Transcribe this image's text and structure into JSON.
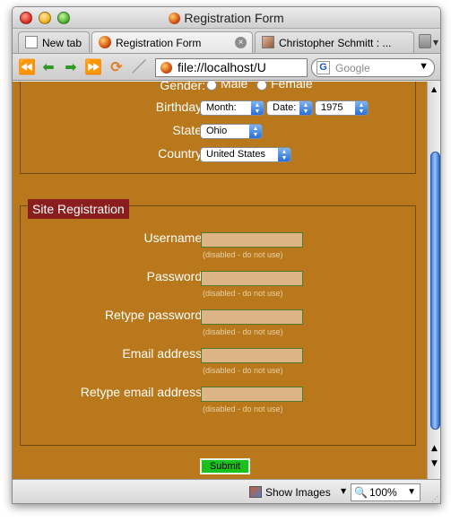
{
  "window": {
    "title": "Registration Form"
  },
  "tabs": [
    {
      "label": "New tab",
      "icon": "new-document-icon"
    },
    {
      "label": "Registration Form",
      "icon": "firefox-icon",
      "active": true
    },
    {
      "label": "Christopher Schmitt : ...",
      "icon": "avatar-icon"
    }
  ],
  "toolbar": {
    "url": "file://localhost/U",
    "search_placeholder": "Google"
  },
  "form": {
    "gender_label": "Gender:",
    "gender_options": [
      "Male",
      "Female"
    ],
    "birthday_label": "Birthday:",
    "month_select": "Month:",
    "date_select": "Date:",
    "year_select": "1975",
    "state_label": "State:",
    "state_select": "Ohio",
    "country_label": "Country:",
    "country_select": "United States"
  },
  "site_registration": {
    "legend": "Site Registration",
    "fields": [
      {
        "label": "Username:",
        "note": "(disabled - do not use)"
      },
      {
        "label": "Password:",
        "note": "(disabled - do not use)"
      },
      {
        "label": "Retype password:",
        "note": "(disabled - do not use)"
      },
      {
        "label": "Email address:",
        "note": "(disabled - do not use)"
      },
      {
        "label": "Retype email address:",
        "note": "(disabled - do not use)"
      }
    ],
    "submit": "Submit"
  },
  "statusbar": {
    "show_images": "Show Images",
    "zoom": "100%"
  },
  "colors": {
    "content_bg": "#b8781b",
    "legend_bg": "#8a1e1e",
    "submit_bg": "#19c11d",
    "disabled_field_bg": "#dcb485"
  }
}
